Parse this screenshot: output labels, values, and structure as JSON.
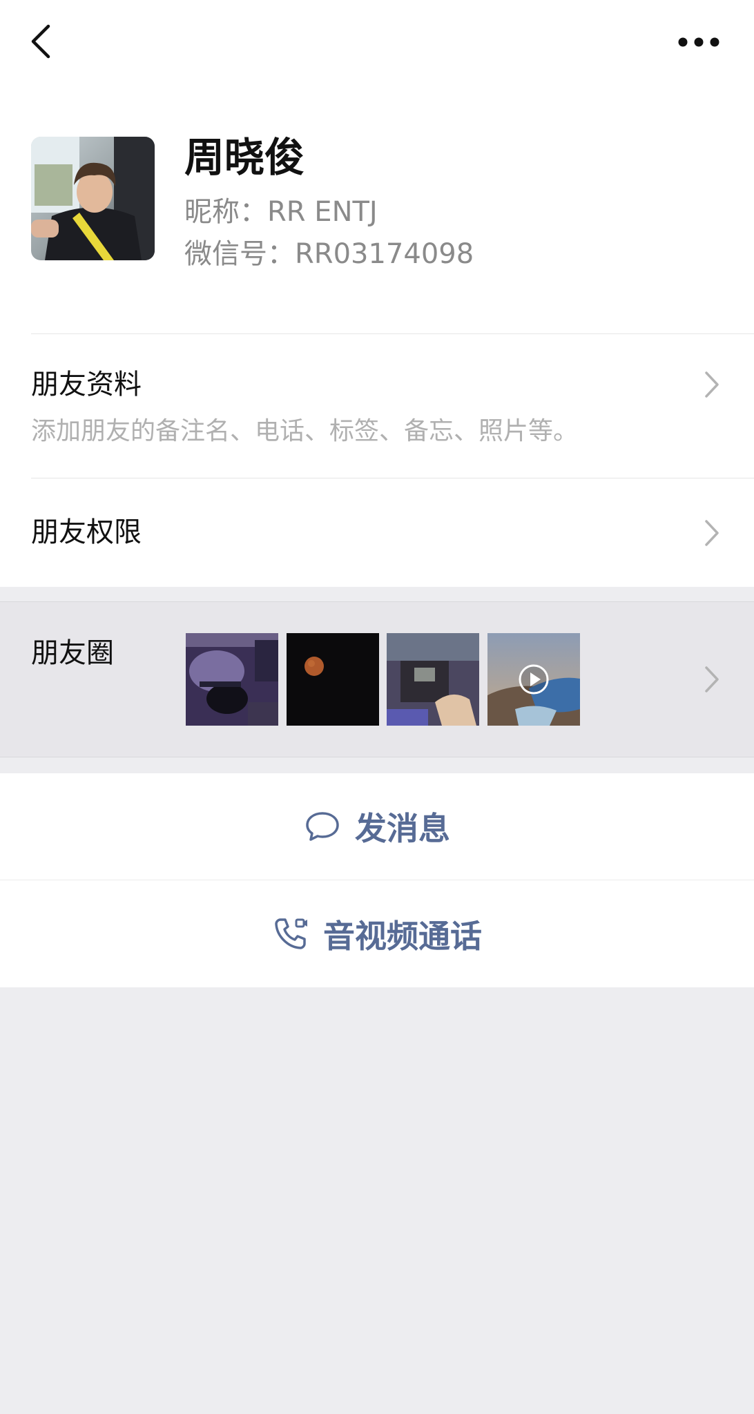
{
  "profile": {
    "name": "周晓俊",
    "nickname": "昵称：RR ENTJ",
    "wechat_id": "微信号：RR03174098"
  },
  "rows": {
    "friend_info": {
      "title": "朋友资料",
      "subtitle": "添加朋友的备注名、电话、标签、备忘、照片等。"
    },
    "friend_permissions": {
      "title": "朋友权限"
    },
    "moments": {
      "title": "朋友圈"
    }
  },
  "actions": {
    "send_message": "发消息",
    "av_call": "音视频通话"
  },
  "icons": {
    "back": "chevron-left-icon",
    "more": "more-dots-icon",
    "message": "chat-bubble-icon",
    "call": "phone-video-icon",
    "play": "play-icon"
  },
  "colors": {
    "link_blue": "#576b95",
    "text_primary": "#111111",
    "text_secondary": "#8a8a8a",
    "page_bg": "#ededf0"
  }
}
